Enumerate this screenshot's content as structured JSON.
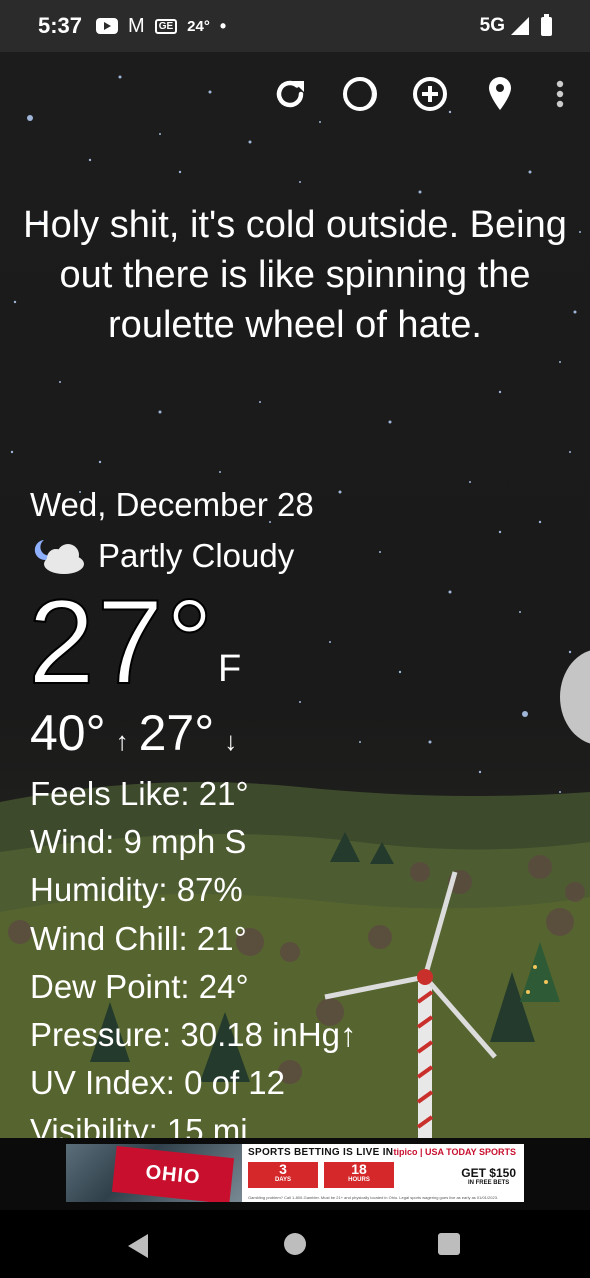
{
  "status_bar": {
    "time": "5:37",
    "weather_temp": "24°",
    "network": "5G",
    "ge_badge": "GE"
  },
  "toolbar": {
    "refresh_icon": "refresh-icon",
    "moon_icon": "moon-phase-icon",
    "add_icon": "add-location-icon",
    "location_icon": "location-pin-icon",
    "more_icon": "more-vert-icon"
  },
  "quote": "Holy shit, it's cold outside. Being out there is like spinning the roulette wheel of hate.",
  "weather": {
    "date": "Wed, December 28",
    "condition": "Partly Cloudy",
    "temperature": "27°",
    "unit": "F",
    "high": "40°",
    "low": "27°",
    "up_arrow": "↑",
    "down_arrow": "↓",
    "details": [
      "Feels Like:  21°",
      "Wind:  9 mph S",
      "Humidity:  87%",
      "Wind Chill:  21°",
      "Dew Point:  24°",
      "Pressure:  30.18 inHg↑",
      "UV Index:  0 of 12",
      "Visibility:  15 mi"
    ]
  },
  "ad": {
    "flag_text": "OHIO",
    "headline": "SPORTS BETTING IS LIVE IN",
    "brand": "tipico | USA TODAY SPORTS",
    "box1_num": "3",
    "box1_label": "DAYS",
    "box2_num": "18",
    "box2_label": "HOURS",
    "cta": "GET $150",
    "cta_sub": "IN FREE BETS",
    "fine_print": "Gambling problem? Call 1-800-Gambler. Must be 21+ and physically located in Ohio. Legal sports wagering goes live as early as 01/01/2023."
  },
  "colors": {
    "sky": "#1c1c1c",
    "ad_red": "#d4282b",
    "status_bar_bg": "#2b2b2b"
  }
}
